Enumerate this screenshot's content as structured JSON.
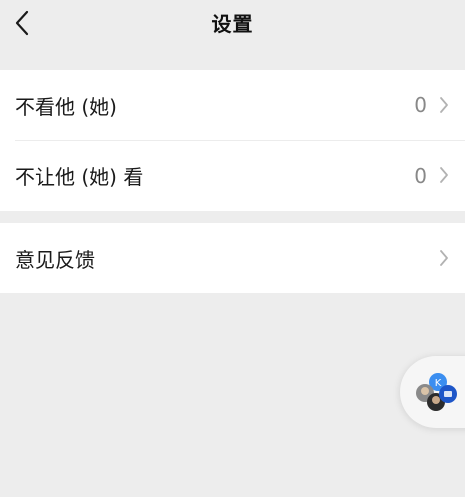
{
  "nav": {
    "title": "设置",
    "back_icon": "chevron-left-icon"
  },
  "settings": {
    "rows": [
      {
        "label": "不看他 (她)",
        "count": "0",
        "icon": "chevron-right-icon"
      },
      {
        "label": "不让他 (她) 看",
        "count": "0",
        "icon": "chevron-right-icon"
      }
    ],
    "feedback": {
      "label": "意见反馈",
      "icon": "chevron-right-icon"
    }
  },
  "floating_ball": {
    "icon": "floating-window-icon",
    "colors": {
      "accent": "#3b8ef0",
      "dark": "#1e56c8"
    }
  }
}
